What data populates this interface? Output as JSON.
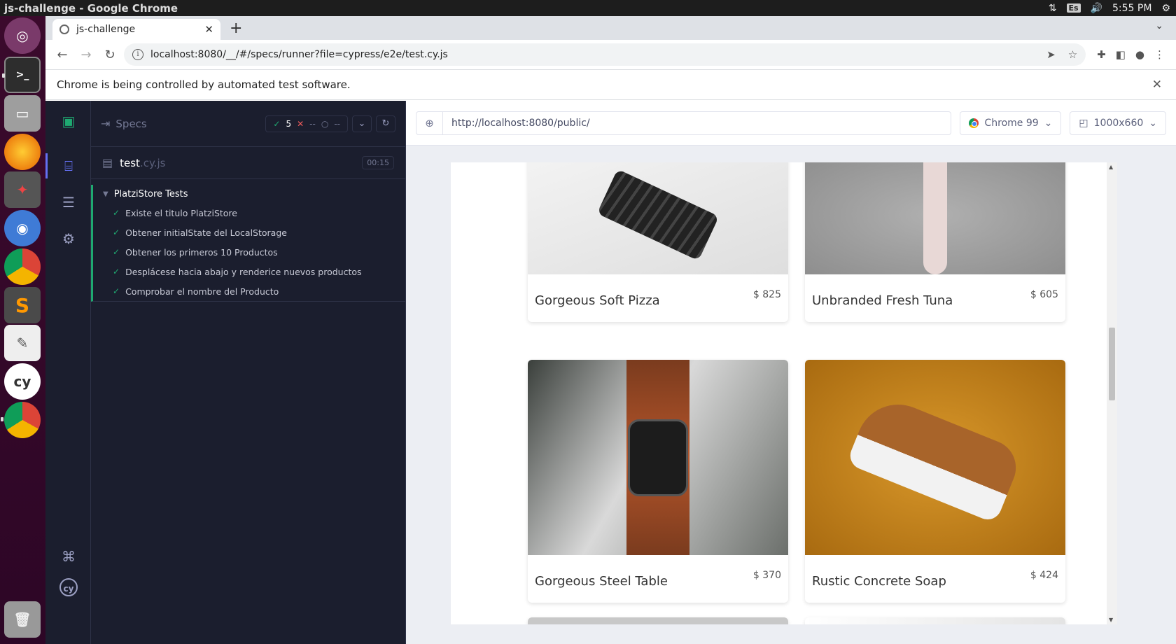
{
  "os": {
    "window_title": "js-challenge - Google Chrome",
    "keyboard_layout": "Es",
    "clock": "5:55 PM"
  },
  "dock": {
    "apps": [
      "ubuntu-icon",
      "terminal-icon",
      "files-icon",
      "firefox-icon",
      "settings-icon",
      "chromium-icon",
      "chrome-icon",
      "sublime-icon",
      "text-editor-icon",
      "cypress-icon",
      "chrome-icon",
      "trash-icon"
    ]
  },
  "browser": {
    "tab_title": "js-challenge",
    "url": "localhost:8080/__/#/specs/runner?file=cypress/e2e/test.cy.js",
    "infobar_text": "Chrome is being controlled by automated test software."
  },
  "reporter": {
    "specs_label": "Specs",
    "passed": "5",
    "failed": "--",
    "pending": "--",
    "spec_name": "test",
    "spec_ext": ".cy.js",
    "duration": "00:15",
    "suite_title": "PlatziStore Tests",
    "tests": [
      "Existe el titulo PlatziStore",
      "Obtener initialState del LocalStorage",
      "Obtener los primeros 10 Productos",
      "Desplácese hacia abajo y renderice nuevos productos",
      "Comprobar el nombre del Producto"
    ]
  },
  "aut": {
    "url": "http://localhost:8080/public/",
    "browser": "Chrome 99",
    "viewport": "1000x660"
  },
  "products": [
    {
      "name": "Gorgeous Soft Pizza",
      "price": "$ 825"
    },
    {
      "name": "Unbranded Fresh Tuna",
      "price": "$ 605"
    },
    {
      "name": "Gorgeous Steel Table",
      "price": "$ 370"
    },
    {
      "name": "Rustic Concrete Soap",
      "price": "$ 424"
    }
  ],
  "colors": {
    "cypress_bg": "#1b1e2e",
    "pass": "#1fa971",
    "fail": "#f15c5c",
    "accent": "#6470f3"
  }
}
